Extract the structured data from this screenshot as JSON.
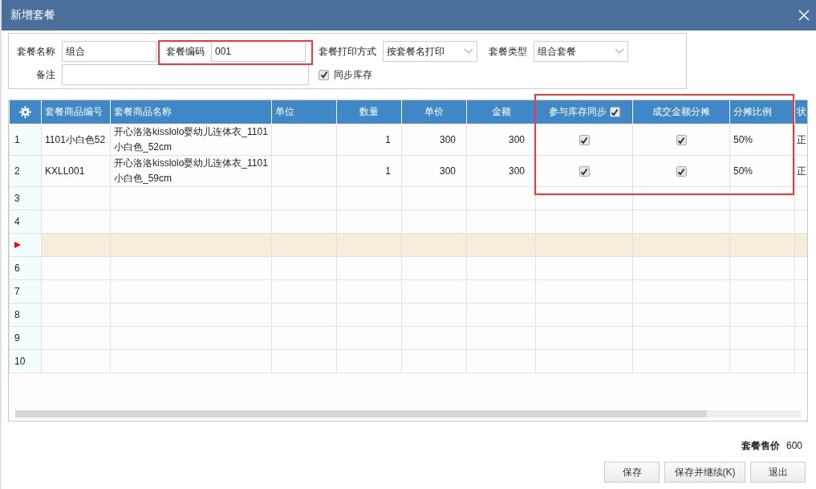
{
  "window": {
    "title": "新增套餐"
  },
  "form": {
    "fields": [
      {
        "kind": "text",
        "label": "套餐名称",
        "value": "组合"
      },
      {
        "kind": "text",
        "label": "套餐编码",
        "value": "001"
      },
      {
        "kind": "select",
        "label": "套餐打印方式",
        "value": "按套餐名打印"
      },
      {
        "kind": "select",
        "label": "套餐类型",
        "value": "组合套餐"
      },
      {
        "kind": "text",
        "label": "备注"
      },
      {
        "kind": "checkbox",
        "label": "同步库存",
        "checked": true
      }
    ]
  },
  "table": {
    "columns": [
      {
        "kind": "settings"
      },
      {
        "kind": "text",
        "label": "套餐商品编号"
      },
      {
        "kind": "text",
        "label": "套餐商品名称"
      },
      {
        "kind": "text",
        "label": "单位"
      },
      {
        "kind": "number",
        "label": "数量"
      },
      {
        "kind": "number",
        "label": "单价"
      },
      {
        "kind": "number",
        "label": "金额"
      },
      {
        "kind": "check",
        "label": "参与库存同步",
        "checked": true
      },
      {
        "kind": "check",
        "label": "成交金额分摊"
      },
      {
        "kind": "text",
        "label": "分摊比例"
      },
      {
        "kind": "text",
        "label": "状"
      }
    ],
    "rows": [
      {
        "number": "1",
        "selected": false,
        "cells": [
          "1101小白色52",
          "开心洛洛kisslolo婴幼儿连体衣_1101小白色_52cm",
          null,
          "1",
          "300",
          "300",
          true,
          true,
          "50%",
          "正"
        ]
      },
      {
        "number": "2",
        "selected": false,
        "cells": [
          "KXLL001",
          "开心洛洛kisslolo婴幼儿连体衣_1101小白色_59cm",
          null,
          "1",
          "300",
          "300",
          true,
          true,
          "50%",
          "正"
        ]
      },
      {
        "number": "3",
        "selected": false
      },
      {
        "number": "4",
        "selected": false
      },
      {
        "selected": true
      },
      {
        "number": "6",
        "selected": false
      },
      {
        "number": "7",
        "selected": false
      },
      {
        "number": "8",
        "selected": false
      },
      {
        "number": "9",
        "selected": false
      },
      {
        "number": "10",
        "selected": false
      }
    ]
  },
  "total": {
    "label": "套餐售价",
    "value": "600"
  },
  "buttons": [
    "保存",
    "保存并继续(K)",
    "退出"
  ]
}
